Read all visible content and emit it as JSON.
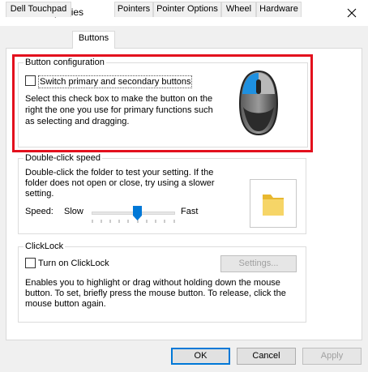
{
  "window": {
    "title": "Mouse Properties"
  },
  "tabs": [
    {
      "label": "Dell Touchpad"
    },
    {
      "label": "Buttons"
    },
    {
      "label": "Pointers"
    },
    {
      "label": "Pointer Options"
    },
    {
      "label": "Wheel"
    },
    {
      "label": "Hardware"
    }
  ],
  "button_config": {
    "group_title": "Button configuration",
    "checkbox_label": "Switch primary and secondary buttons",
    "checked": false,
    "description_lines": [
      "Select this check box to make the button on the",
      "right the one you use for primary functions such",
      "as selecting and dragging."
    ]
  },
  "double_click": {
    "group_title": "Double-click speed",
    "description_lines": [
      "Double-click the folder to test your setting. If the",
      "folder does not open or close, try using a slower",
      "setting."
    ],
    "speed_label": "Speed:",
    "slow_label": "Slow",
    "fast_label": "Fast",
    "speed_fraction": 0.55
  },
  "clicklock": {
    "group_title": "ClickLock",
    "checkbox_label": "Turn on ClickLock",
    "checked": false,
    "settings_button": "Settings...",
    "description_lines": [
      "Enables you to highlight or drag without holding down the mouse",
      "button. To set, briefly press the mouse button. To release, click the",
      "mouse button again."
    ]
  },
  "footer": {
    "ok": "OK",
    "cancel": "Cancel",
    "apply": "Apply"
  },
  "colors": {
    "highlight": "#e3101d",
    "mouse_accent": "#1e90e0",
    "default_border": "#0078d7"
  }
}
